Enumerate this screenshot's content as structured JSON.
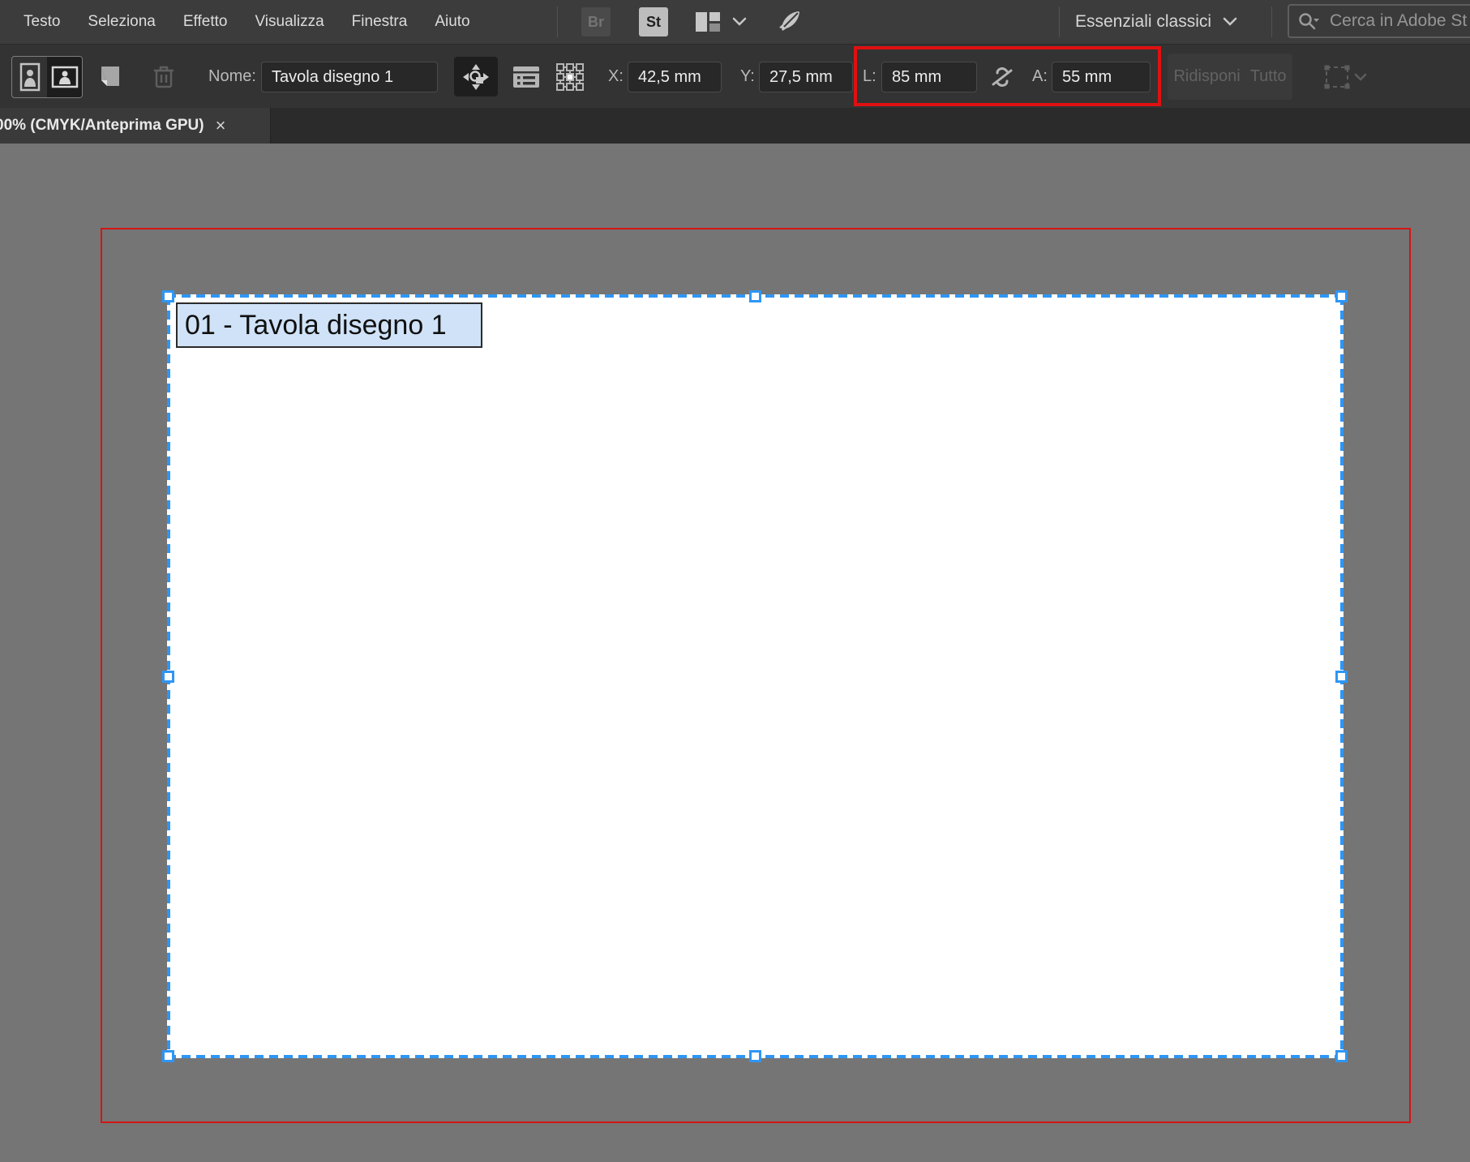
{
  "menu": {
    "items": [
      "Testo",
      "Seleziona",
      "Effetto",
      "Visualizza",
      "Finestra",
      "Aiuto"
    ]
  },
  "appbar": {
    "bridge_label": "Br",
    "stock_label": "St",
    "workspace": "Essenziali classici",
    "search_placeholder": "Cerca in Adobe St"
  },
  "toolbar": {
    "name_label": "Nome:",
    "name_value": "Tavola disegno 1",
    "x_label": "X:",
    "x_value": "42,5 mm",
    "y_label": "Y:",
    "y_value": "27,5 mm",
    "width_label": "L:",
    "width_value": "85 mm",
    "height_label": "A:",
    "height_value": "55 mm",
    "rearrange_label": "Ridisponi",
    "all_label": "Tutto"
  },
  "tabbar": {
    "active_tab": "00% (CMYK/Anteprima GPU)",
    "close_glyph": "×"
  },
  "canvas": {
    "artboard_label": "01 - Tavola disegno 1"
  },
  "icons": {
    "menubar": [
      "bridge-icon",
      "stock-icon",
      "workspace-layout-icon",
      "rocket-icon",
      "search-icon",
      "chevron-down-icon"
    ],
    "toolbar": [
      "portrait-orientation-icon",
      "landscape-orientation-icon",
      "new-artboard-icon",
      "trash-icon",
      "move-artboard-icon",
      "artboard-options-icon",
      "reference-point-icon",
      "unlink-icon",
      "rearrange-artboards-icon"
    ]
  },
  "colors": {
    "selection_blue": "#2e96f5",
    "annotation_red": "#e01010",
    "canvas_gray": "#757575",
    "artboard_label_bg": "#cfe2f7",
    "menubar_bg": "#3c3c3c",
    "toolbar_bg": "#333333"
  }
}
